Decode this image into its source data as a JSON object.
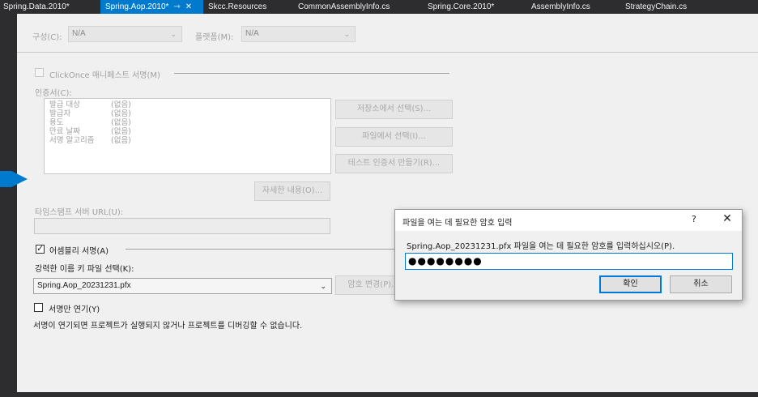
{
  "tabs": [
    {
      "label": "Spring.Data.2010*"
    },
    {
      "label": "Spring.Aop.2010*",
      "pin": "⇾",
      "close": "✕"
    },
    {
      "label": "Skcc.Resources"
    },
    {
      "label": "CommonAssemblyInfo.cs"
    },
    {
      "label": "Spring.Core.2010*"
    },
    {
      "label": "AssemblyInfo.cs"
    },
    {
      "label": "StrategyChain.cs"
    }
  ],
  "config": {
    "config_label": "구성(C):",
    "config_value": "N/A",
    "platform_label": "플랫폼(M):",
    "platform_value": "N/A"
  },
  "clickonce": {
    "checkbox_label": "ClickOnce 매니페스트 서명(M)",
    "certificate_label": "인증서(C):",
    "cert_rows": [
      {
        "key": "발급 대상",
        "value": "(없음)"
      },
      {
        "key": "발급자",
        "value": "(없음)"
      },
      {
        "key": "용도",
        "value": "(없음)"
      },
      {
        "key": "만료 날짜",
        "value": "(없음)"
      },
      {
        "key": "서명 알고리즘",
        "value": "(없음)"
      }
    ],
    "select_from_store": "저장소에서 선택(S)...",
    "select_from_file": "파일에서 선택(I)...",
    "create_test_cert": "테스트 인증서 만들기(R)...",
    "more_details": "자세한 내용(O)...",
    "timestamp_label": "타임스탬프 서버 URL(U):",
    "timestamp_value": ""
  },
  "assembly": {
    "sign_checkbox_label": "어셈블리 서명(A)",
    "sign_checked": true,
    "key_file_label": "강력한 이름 키 파일 선택(K):",
    "key_file_value": "Spring.Aop_20231231.pfx",
    "change_password_button": "암호 변경(P)...",
    "delay_sign_label": "서명만 연기(Y)",
    "delay_sign_checked": false,
    "delay_note": "서명이 연기되면 프로젝트가 실행되지 않거나 프로젝트를 디버깅할 수 없습니다."
  },
  "dialog": {
    "title": "파일을 여는 데 필요한 암호 입력",
    "help": "?",
    "close": "✕",
    "prompt": "Spring.Aop_20231231.pfx 파일을 여는 데 필요한 암호를 입력하십시오(P).",
    "password_value": "●●●●●●●●",
    "ok_button": "확인",
    "cancel_button": "취소"
  },
  "icons": {
    "chevron": "⌄",
    "check": "✓"
  },
  "colors": {
    "accent": "#007acc",
    "tabbar": "#2d2d30",
    "panel": "#f0f0f0",
    "focus": "#0078d7"
  }
}
